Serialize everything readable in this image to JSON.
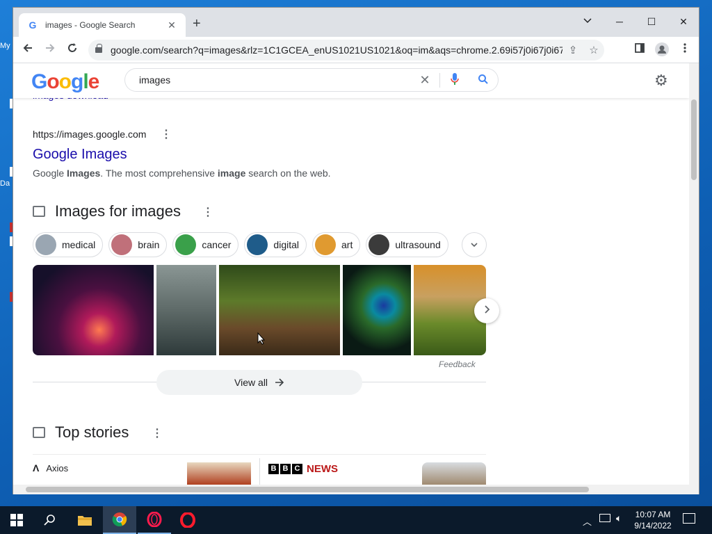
{
  "desktop": {
    "labels": [
      "My",
      "Da"
    ]
  },
  "browser": {
    "tab_title": "images - Google Search",
    "tab_favicon": "G",
    "url": "google.com/search?q=images&rlz=1C1GCEA_enUS1021US1021&oq=im&aqs=chrome.2.69i57j0i67j0i67i1...",
    "controls": {
      "minimize": "⌄",
      "min": "─",
      "max": "☐",
      "close": "✕"
    }
  },
  "search": {
    "logo": "Google",
    "query": "images"
  },
  "result": {
    "cut_text": "images download",
    "cite": "https://images.google.com",
    "title": "Google Images",
    "snippet_parts": [
      "Google ",
      "Images",
      ". The most comprehensive ",
      "image",
      " search on the web."
    ]
  },
  "images_section": {
    "title": "Images for images",
    "chips": [
      {
        "label": "medical",
        "color": "#9aa6b2"
      },
      {
        "label": "brain",
        "color": "#c0707a"
      },
      {
        "label": "cancer",
        "color": "#3aa04a"
      },
      {
        "label": "digital",
        "color": "#1f5c8a"
      },
      {
        "label": "art",
        "color": "#e09a30"
      },
      {
        "label": "ultrasound",
        "color": "#3b3b3b"
      }
    ],
    "feedback": "Feedback",
    "view_all": "View all"
  },
  "top_stories": {
    "title": "Top stories",
    "source1": "Axios",
    "source2_news": "NEWS",
    "source2_letters": [
      "B",
      "B",
      "C"
    ]
  },
  "taskbar": {
    "time": "10:07 AM",
    "date": "9/14/2022"
  }
}
